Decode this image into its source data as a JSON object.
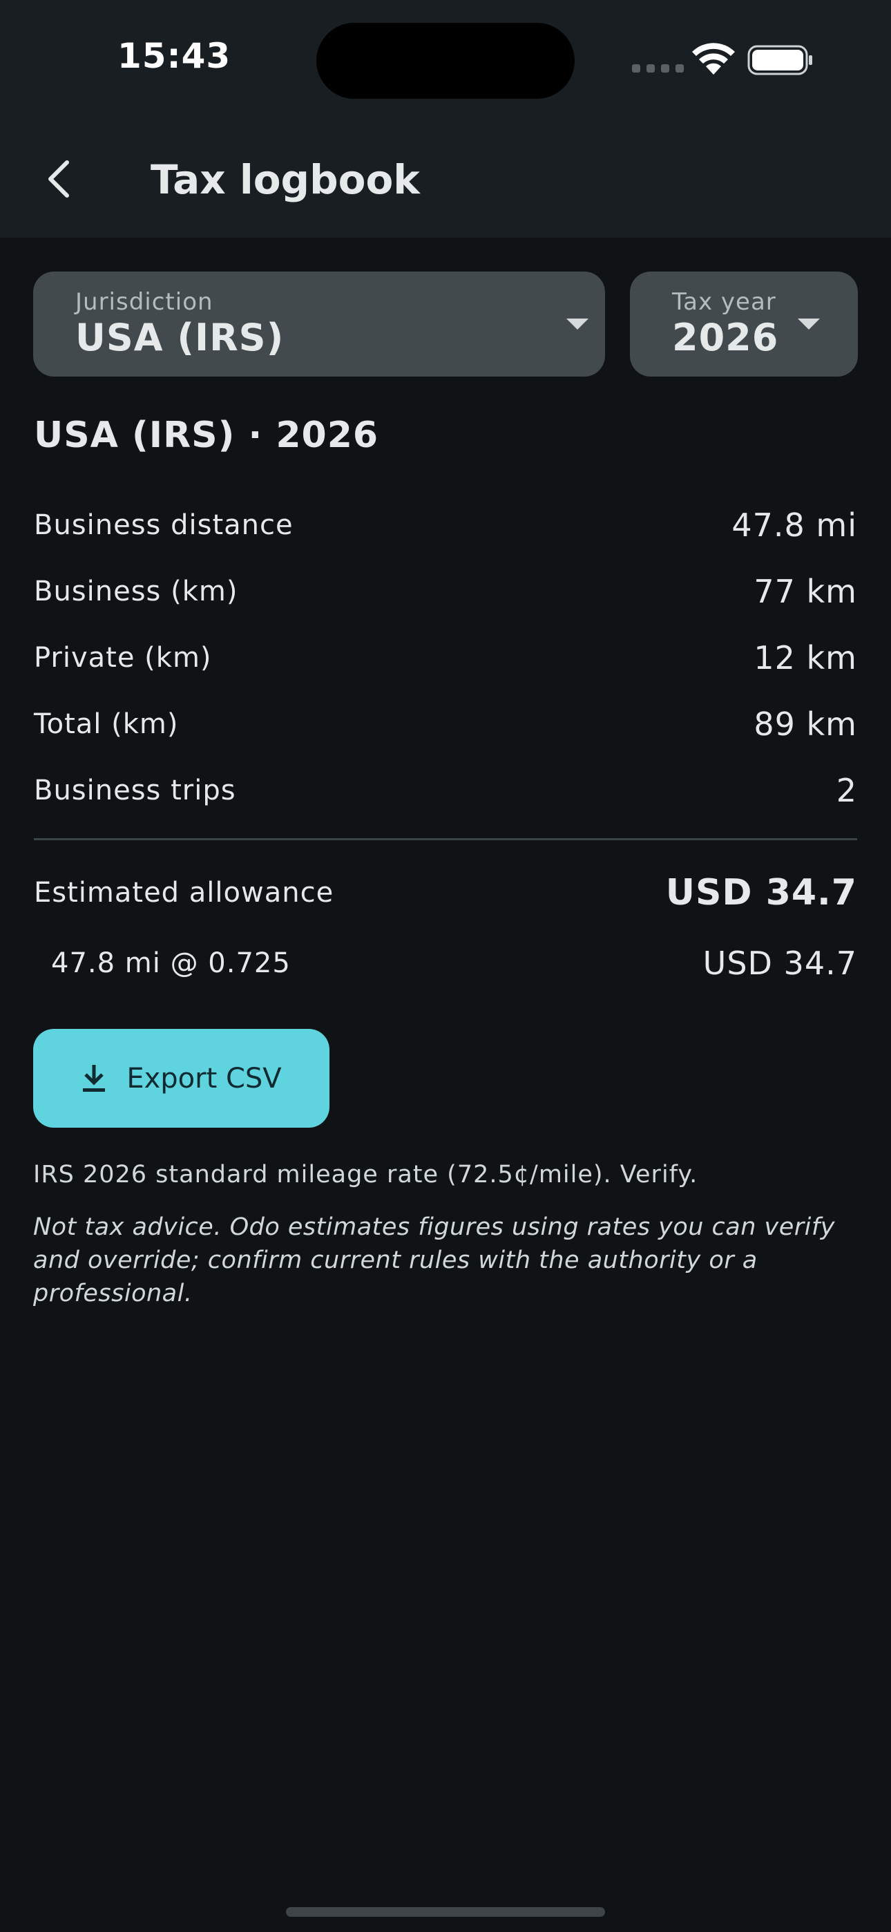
{
  "status_bar": {
    "time": "15:43"
  },
  "app_bar": {
    "title": "Tax logbook",
    "back_icon": "chevron-left-icon"
  },
  "filters": {
    "jurisdiction": {
      "label": "Jurisdiction",
      "value": "USA (IRS)"
    },
    "tax_year": {
      "label": "Tax year",
      "value": "2026"
    }
  },
  "summary": {
    "heading": "USA (IRS) · 2026",
    "rows": [
      {
        "label": "Business distance",
        "value": "47.8 mi"
      },
      {
        "label": "Business (km)",
        "value": "77 km"
      },
      {
        "label": "Private (km)",
        "value": "12 km"
      },
      {
        "label": "Total (km)",
        "value": "89 km"
      },
      {
        "label": "Business trips",
        "value": "2"
      }
    ],
    "allowance": {
      "label": "Estimated allowance",
      "value": "USD 34.7"
    },
    "breakdown": {
      "label": "47.8 mi @ 0.725",
      "value": "USD 34.7"
    }
  },
  "export": {
    "label": "Export CSV",
    "icon": "download-icon"
  },
  "rate_note": "IRS 2026 standard mileage rate (72.5¢/mile). Verify.",
  "disclaimer": "Not tax advice. Odo estimates figures using rates you can verify and override; confirm current rules with the authority or a professional.",
  "colors": {
    "accent": "#5fd4de",
    "background": "#0f1316",
    "surface": "#424a4d"
  }
}
